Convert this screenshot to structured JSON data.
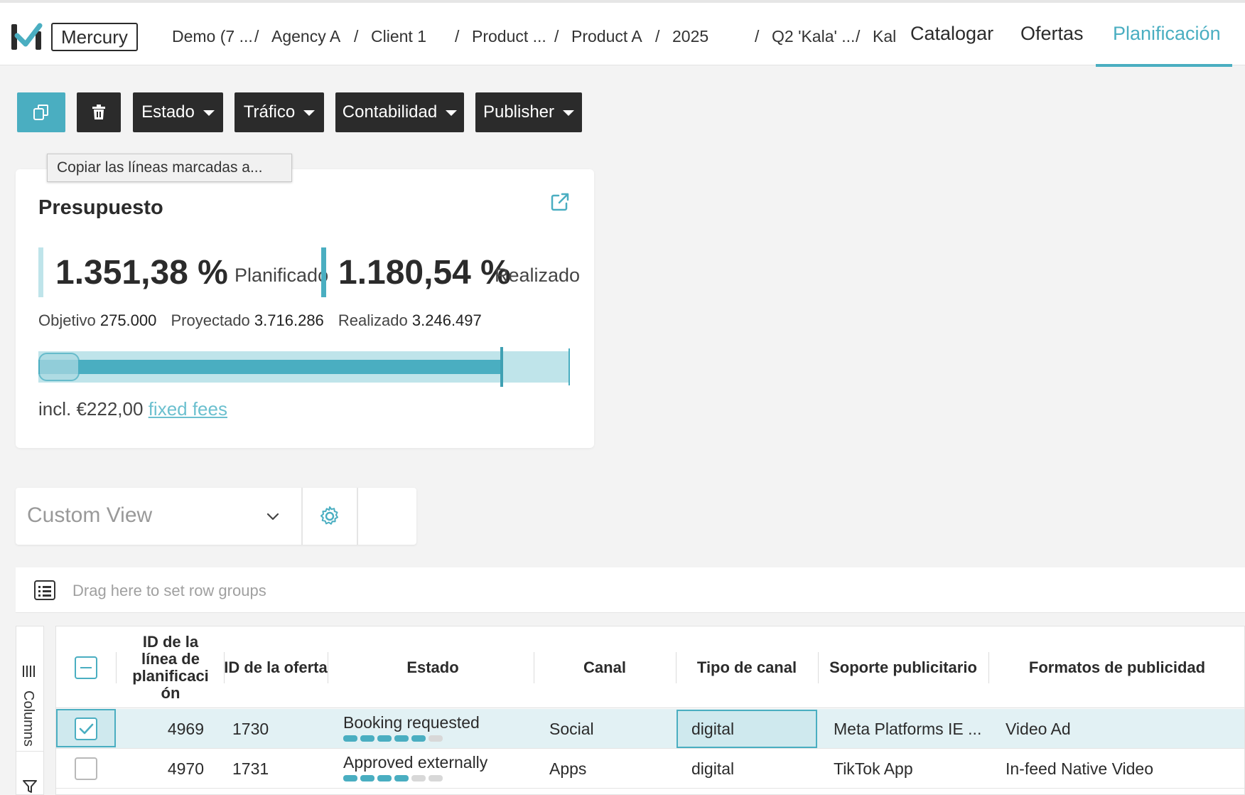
{
  "app": {
    "brand": "Mercury"
  },
  "breadcrumbs": [
    "Demo (7 ...",
    "Agency A",
    "Client 1",
    "Product ...",
    "Product A",
    "2025",
    "Q2 'Kala' ...",
    "Kal"
  ],
  "nav": {
    "tabs": [
      "Catalogar",
      "Ofertas",
      "Planificación"
    ],
    "active": "Planificación"
  },
  "toolbar": {
    "copy_icon": "copy-icon",
    "delete_icon": "trash-icon",
    "dropdowns": [
      "Estado",
      "Tráfico",
      "Contabilidad",
      "Publisher"
    ],
    "tooltip": "Copiar las líneas marcadas a..."
  },
  "budget": {
    "title": "Presupuesto",
    "planned_value": "1.351,38 %",
    "planned_label": "Planificado",
    "realized_value": "1.180,54 %",
    "realized_label": "Realizado",
    "objective_label": "Objetivo",
    "objective_value": "275.000",
    "projected_label": "Proyectado",
    "projected_value": "3.716.286",
    "realized_total_label": "Realizado",
    "realized_total_value": "3.246.497",
    "fees_prefix": "incl. €222,00",
    "fees_link": "fixed fees",
    "colors": {
      "accent": "#4aaec1",
      "light": "#bfe4ea"
    }
  },
  "view": {
    "placeholder": "Custom View"
  },
  "grouping": {
    "text": "Drag here to set row groups"
  },
  "side": {
    "columns_label": "Columns"
  },
  "grid": {
    "headers": [
      "ID de la línea de planificaci ón",
      "ID de la oferta",
      "Estado",
      "Canal",
      "Tipo de canal",
      "Soporte publicitario",
      "Formatos de publicidad"
    ],
    "rows": [
      {
        "id": "4969",
        "offer": "1730",
        "status": "Booking requested",
        "progress": 5,
        "progress_total": 6,
        "channel": "Social",
        "channel_type": "digital",
        "support": "Meta Platforms IE ...",
        "format": "Video Ad",
        "selected": true
      },
      {
        "id": "4970",
        "offer": "1731",
        "status": "Approved externally",
        "progress": 4,
        "progress_total": 6,
        "channel": "Apps",
        "channel_type": "digital",
        "support": "TikTok App",
        "format": "In-feed Native Video",
        "selected": false
      }
    ]
  }
}
